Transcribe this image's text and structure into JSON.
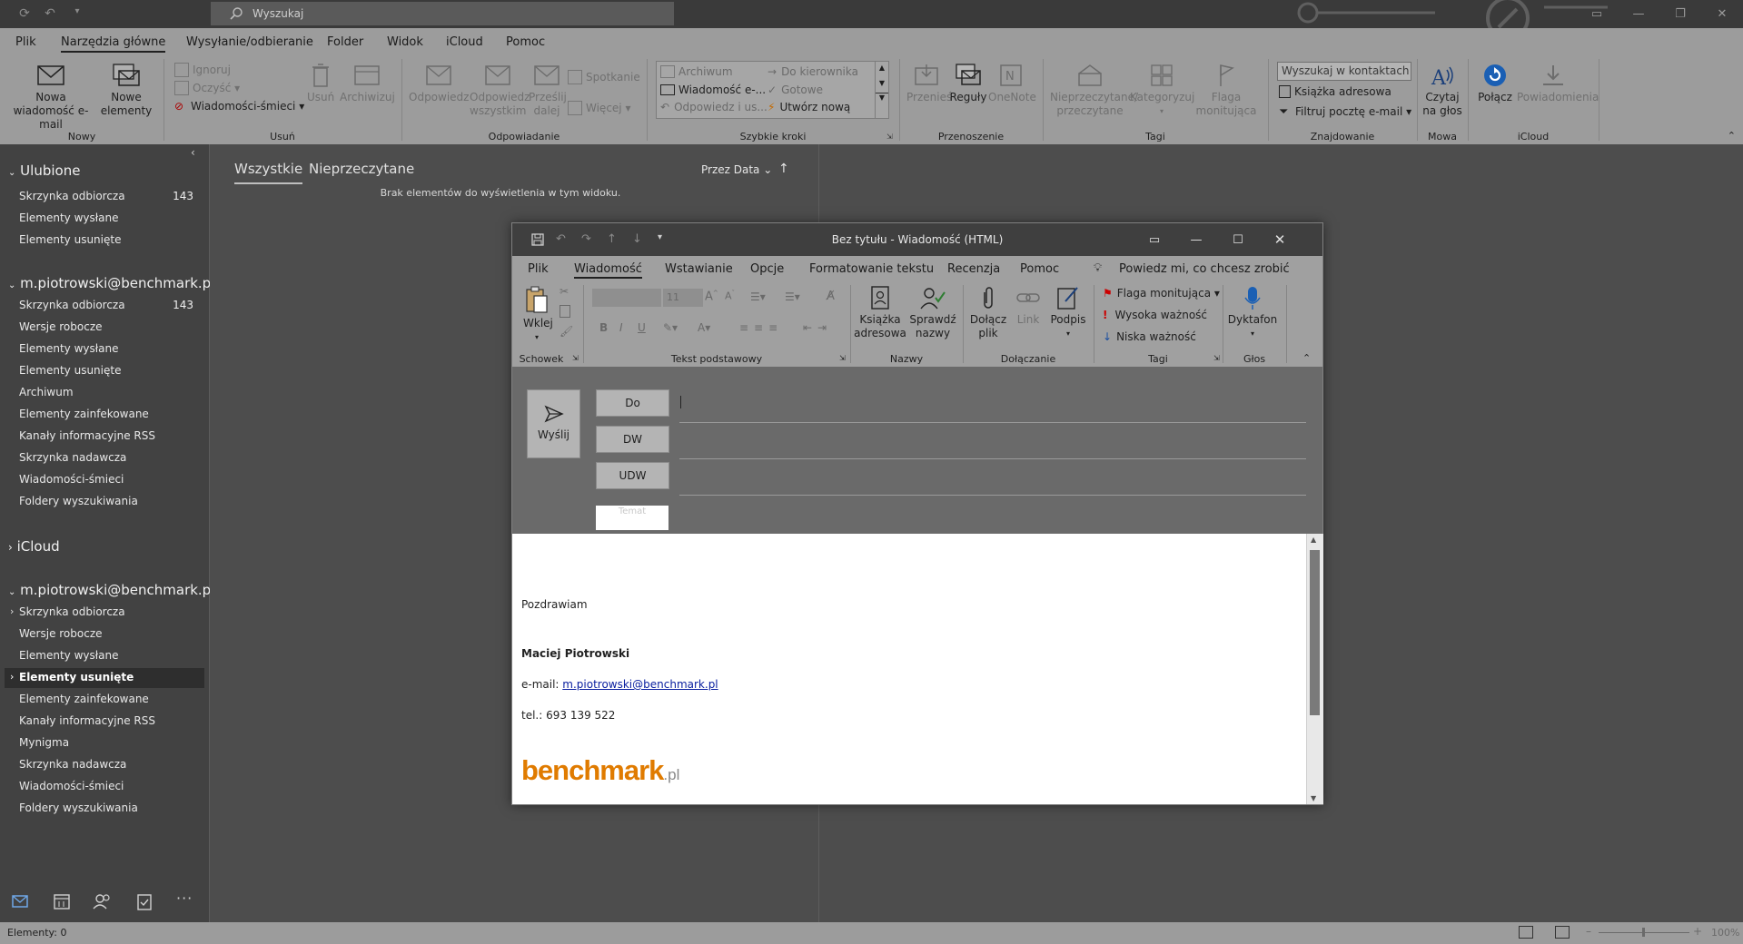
{
  "search": {
    "label": "Wyszukaj"
  },
  "menu": [
    "Plik",
    "Narzędzia główne",
    "Wysyłanie/odbieranie",
    "Folder",
    "Widok",
    "iCloud",
    "Pomoc"
  ],
  "ribbon": {
    "new_email": "Nowa wiadomość e-mail",
    "new_items": "Nowe elementy",
    "ignore": "Ignoruj",
    "clean": "Oczyść",
    "junk": "Wiadomości-śmieci",
    "delete": "Usuń",
    "archive": "Archiwizuj",
    "reply": "Odpowiedz",
    "reply_all": "Odpowiedz wszystkim",
    "forward": "Prześlij dalej",
    "meeting": "Spotkanie",
    "more": "Więcej",
    "qs_archive": "Archiwum",
    "qs_manager": "Do kierownika",
    "qs_email": "Wiadomość e-...",
    "qs_done": "Gotowe",
    "qs_reply": "Odpowiedz i us...",
    "qs_new": "Utwórz nową",
    "move": "Przenieś",
    "rules": "Reguły",
    "onenote": "OneNote",
    "unread": "Nieprzeczytane/ przeczytane",
    "categorize": "Kategoryzuj",
    "flag": "Flaga monitująca",
    "contact_search": "Wyszukaj w kontaktach",
    "address_book": "Książka adresowa",
    "filter_email": "Filtruj pocztę e-mail",
    "read_aloud": "Czytaj na głos",
    "connect": "Połącz",
    "notifications": "Powiadomienia",
    "groups": {
      "new": "Nowy",
      "delete": "Usuń",
      "respond": "Odpowiadanie",
      "quick_steps": "Szybkie kroki",
      "move": "Przenoszenie",
      "tags": "Tagi",
      "find": "Znajdowanie",
      "speech": "Mowa",
      "icloud": "iCloud"
    }
  },
  "nav": {
    "favorites_header": "Ulubione",
    "favorites": [
      {
        "label": "Skrzynka odbiorcza",
        "count": "143"
      },
      {
        "label": "Elementy wysłane"
      },
      {
        "label": "Elementy usunięte"
      }
    ],
    "account1_header": "m.piotrowski@benchmark.pl",
    "account1": [
      {
        "label": "Skrzynka odbiorcza",
        "count": "143"
      },
      {
        "label": "Wersje robocze"
      },
      {
        "label": "Elementy wysłane"
      },
      {
        "label": "Elementy usunięte"
      },
      {
        "label": "Archiwum"
      },
      {
        "label": "Elementy zainfekowane"
      },
      {
        "label": "Kanały informacyjne RSS"
      },
      {
        "label": "Skrzynka nadawcza"
      },
      {
        "label": "Wiadomości-śmieci"
      },
      {
        "label": "Foldery wyszukiwania"
      }
    ],
    "icloud_header": "iCloud",
    "account2_header": "m.piotrowski@benchmark.pl",
    "account2": [
      {
        "label": "Skrzynka odbiorcza"
      },
      {
        "label": "Wersje robocze"
      },
      {
        "label": "Elementy wysłane"
      },
      {
        "label": "Elementy usunięte"
      },
      {
        "label": "Elementy zainfekowane"
      },
      {
        "label": "Kanały informacyjne RSS"
      },
      {
        "label": "Mynigma"
      },
      {
        "label": "Skrzynka nadawcza"
      },
      {
        "label": "Wiadomości-śmieci"
      },
      {
        "label": "Foldery wyszukiwania"
      }
    ]
  },
  "list": {
    "tab_all": "Wszystkie",
    "tab_unread": "Nieprzeczytane",
    "sort": "Przez Data",
    "empty": "Brak elementów do wyświetlenia w tym widoku."
  },
  "status": {
    "items": "Elementy: 0",
    "zoom": "100%"
  },
  "compose": {
    "title": "Bez tytułu  -  Wiadomość (HTML)",
    "menu": [
      "Plik",
      "Wiadomość",
      "Wstawianie",
      "Opcje",
      "Formatowanie tekstu",
      "Recenzja",
      "Pomoc"
    ],
    "tell_me": "Powiedz mi, co chcesz zrobić",
    "ribbon": {
      "paste": "Wklej",
      "font_size": "11",
      "address_book": "Książka adresowa",
      "check_names": "Sprawdź nazwy",
      "attach_file": "Dołącz plik",
      "link": "Link",
      "signature": "Podpis",
      "flag": "Flaga monitująca",
      "high": "Wysoka ważność",
      "low": "Niska ważność",
      "dictate": "Dyktafon",
      "groups": {
        "clipboard": "Schowek",
        "basic_text": "Tekst podstawowy",
        "names": "Nazwy",
        "include": "Dołączanie",
        "tags": "Tagi",
        "voice": "Głos"
      }
    },
    "send": "Wyślij",
    "to": "Do",
    "cc": "DW",
    "bcc": "UDW",
    "subject_placeholder": "Temat",
    "body": {
      "greeting": "Pozdrawiam",
      "name": "Maciej Piotrowski",
      "email_label": "e-mail: ",
      "email": "m.piotrowski@benchmark.pl",
      "phone": "tel.: 693 139 522",
      "logo_main": "benchmark",
      "logo_suffix": ".pl"
    }
  }
}
